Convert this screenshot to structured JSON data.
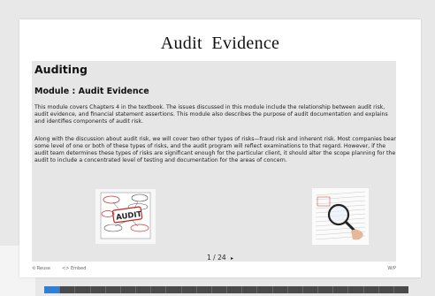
{
  "slide": {
    "title": "Audit  Evidence",
    "heading": "Auditing",
    "subheading": "Module :  Audit Evidence",
    "paragraph1": "This module covers Chapters 4 in the textbook. The issues discussed in this module include the relationship between audit risk, audit evidence, and financial statement assertions. This module also describes the purpose of audit documentation and explains and identifies components of audit risk.",
    "paragraph2": "Along with the discussion about audit risk, we will cover two other types of risks—fraud risk and inherent risk. Most companies bear some level of one or both of these types of risks, and the audit program will reflect examinations to that regard. However, if the audit team determines these types of risks are significant enough for the particular client, it should alter the scope planning for the audit to include a concentrated level of testing and documentation for the areas of concern.",
    "left_image_word": "AUDIT",
    "right_image_icon": "magnifier-on-documents"
  },
  "pager": {
    "current": "1",
    "separator": "/",
    "total": "24",
    "next_icon": "▸"
  },
  "progress": {
    "value": 0.0417,
    "segments": 24,
    "fill_color": "#2f7fd6",
    "track_color": "#4a4a4a"
  },
  "footer": {
    "reuse_label": "⟲ Reuse",
    "embed_label": "<> Embed",
    "brand_label": "W/P"
  }
}
